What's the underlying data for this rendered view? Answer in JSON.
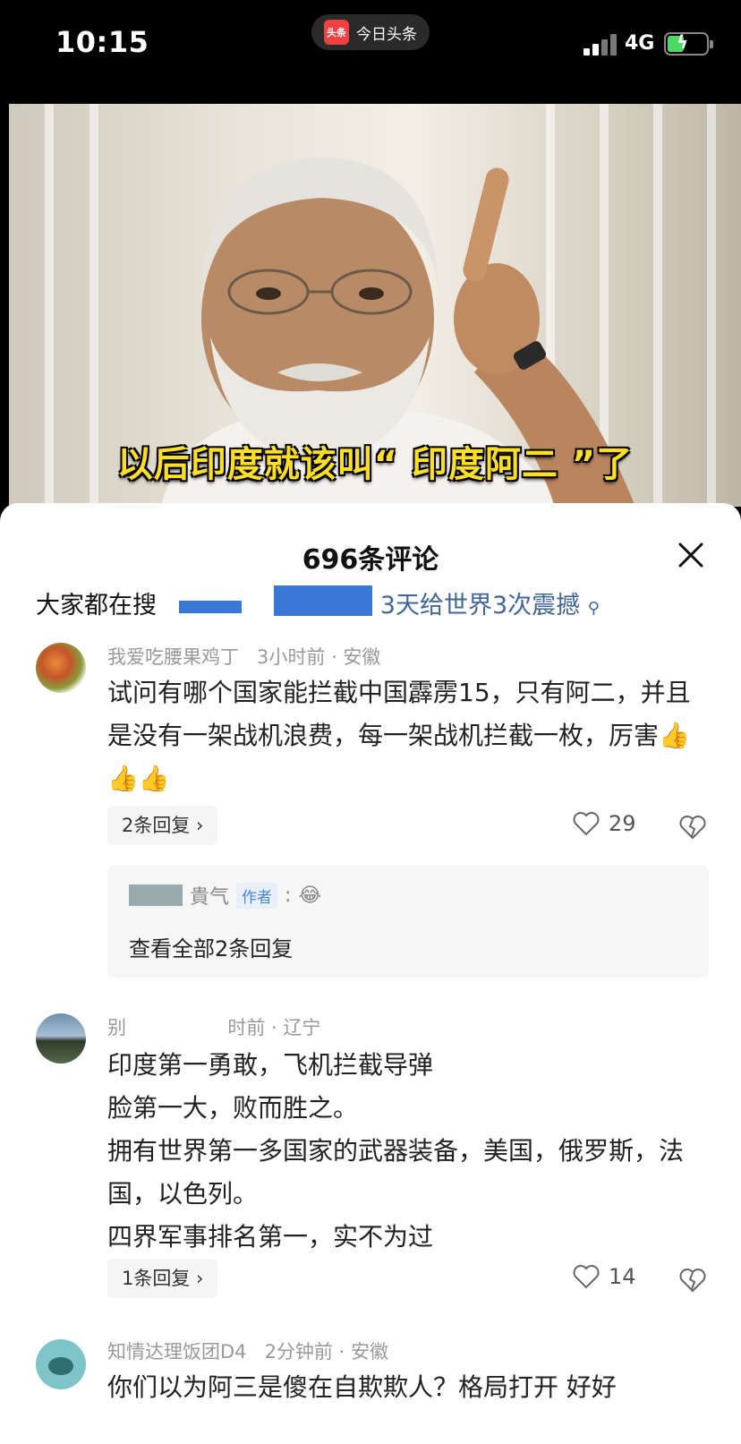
{
  "status_bar": {
    "time": "10:15",
    "app_name": "今日头条",
    "app_logo_text": "头条",
    "network": "4G"
  },
  "video": {
    "caption": "以后印度就该叫“ 印度阿二 ”了"
  },
  "sheet": {
    "title": "696条评论",
    "search_prefix": "大家都在搜",
    "search_visible_text": "3天给世界3次震撼"
  },
  "comments": [
    {
      "user": "我爱吃腰果鸡丁",
      "time_location": "3小时前 · 安徽",
      "text": "试问有哪个国家能拦截中国霹雳15，只有阿二，并且是没有一架战机浪费，每一架战机拦截一枚，厉害👍👍👍",
      "replies_label": "2条回复",
      "likes": "29",
      "reply_preview": {
        "author": "貴气",
        "author_tag": "作者",
        "content": "😂",
        "view_all": "查看全部2条回复"
      }
    },
    {
      "user": "别",
      "time_location": "时前 · 辽宁",
      "lines": [
        "印度第一勇敢，飞机拦截导弹",
        "脸第一大，败而胜之。",
        "拥有世界第一多国家的武器装备，美国，俄罗斯，法国，以色列。",
        "四界军事排名第一，实不为过"
      ],
      "replies_label": "1条回复",
      "likes": "14"
    },
    {
      "user": "知情达理饭团D4",
      "time_location": "2分钟前 · 安徽",
      "text": "你们以为阿三是傻在自欺欺人？格局打开 好好"
    }
  ]
}
